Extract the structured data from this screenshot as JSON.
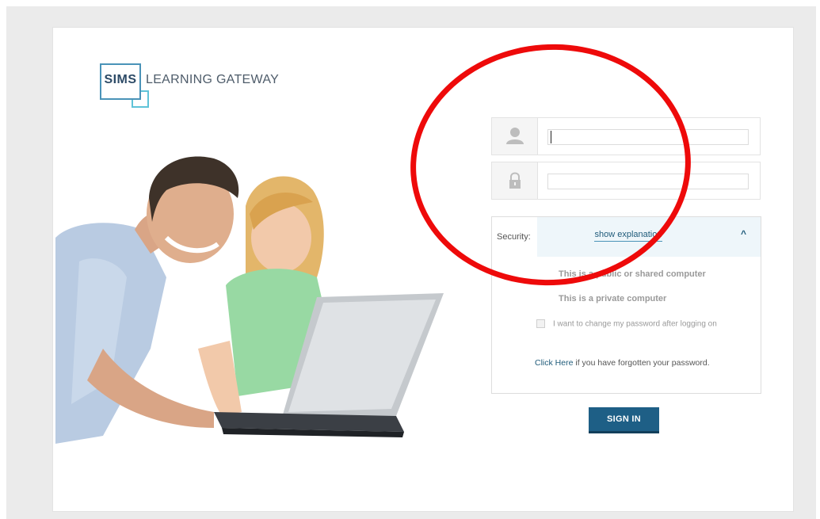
{
  "logo": {
    "brand": "SIMS",
    "name": "LEARNING GATEWAY"
  },
  "login": {
    "username_value": "",
    "password_value": ""
  },
  "security": {
    "label": "Security:",
    "toggle_label": "show explanation",
    "options": [
      "This is a public or shared computer",
      "This is a private computer"
    ],
    "change_password_label": "I want to change my password after logging on",
    "forgot_link": "Click Here",
    "forgot_text": " if you have forgotten your password."
  },
  "signin_label": "SIGN IN",
  "colors": {
    "brand": "#1e5f86",
    "accent": "#4a93b8",
    "annotation": "#ee0a0a"
  }
}
